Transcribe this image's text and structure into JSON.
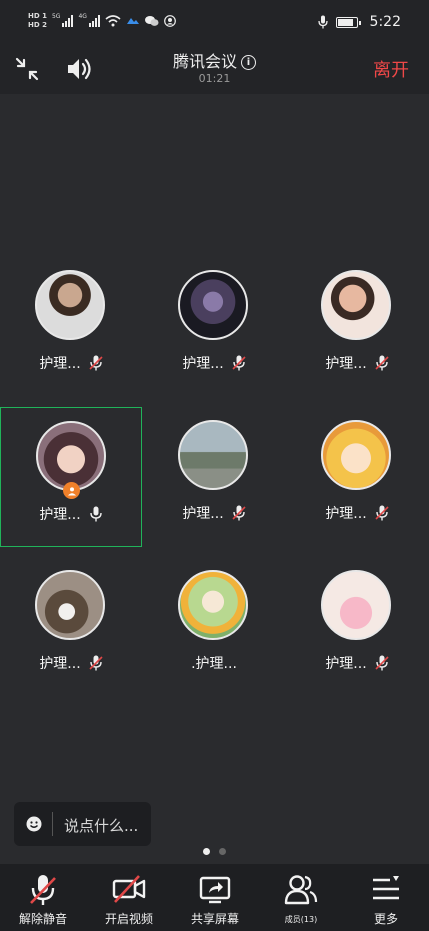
{
  "status_bar": {
    "time": "5:22",
    "hd1": "HD 1",
    "hd2": "HD 2",
    "net1": "5G",
    "net2": "4G"
  },
  "header": {
    "title": "腾讯会议",
    "duration": "01:21",
    "leave": "离开"
  },
  "participants": [
    {
      "name": "护理...",
      "mic": "muted"
    },
    {
      "name": "护理...",
      "mic": "muted"
    },
    {
      "name": "护理...",
      "mic": "muted"
    },
    {
      "name": "护理...",
      "mic": "on",
      "host": true,
      "active": true
    },
    {
      "name": "护理...",
      "mic": "muted"
    },
    {
      "name": "护理...",
      "mic": "muted"
    },
    {
      "name": "护理...",
      "mic": "muted"
    },
    {
      "name": ".护理...",
      "mic": "none"
    },
    {
      "name": "护理...",
      "mic": "muted"
    }
  ],
  "chat": {
    "placeholder": "说点什么..."
  },
  "pager": {
    "pages": 2,
    "current": 1
  },
  "toolbar": {
    "unmute": "解除静音",
    "video": "开启视频",
    "share": "共享屏幕",
    "members": "成员(13)",
    "more": "更多"
  },
  "colors": {
    "leave": "#f04848",
    "active_border": "#20b35a",
    "host_badge": "#f0802a",
    "muted_slash": "#e04848"
  }
}
